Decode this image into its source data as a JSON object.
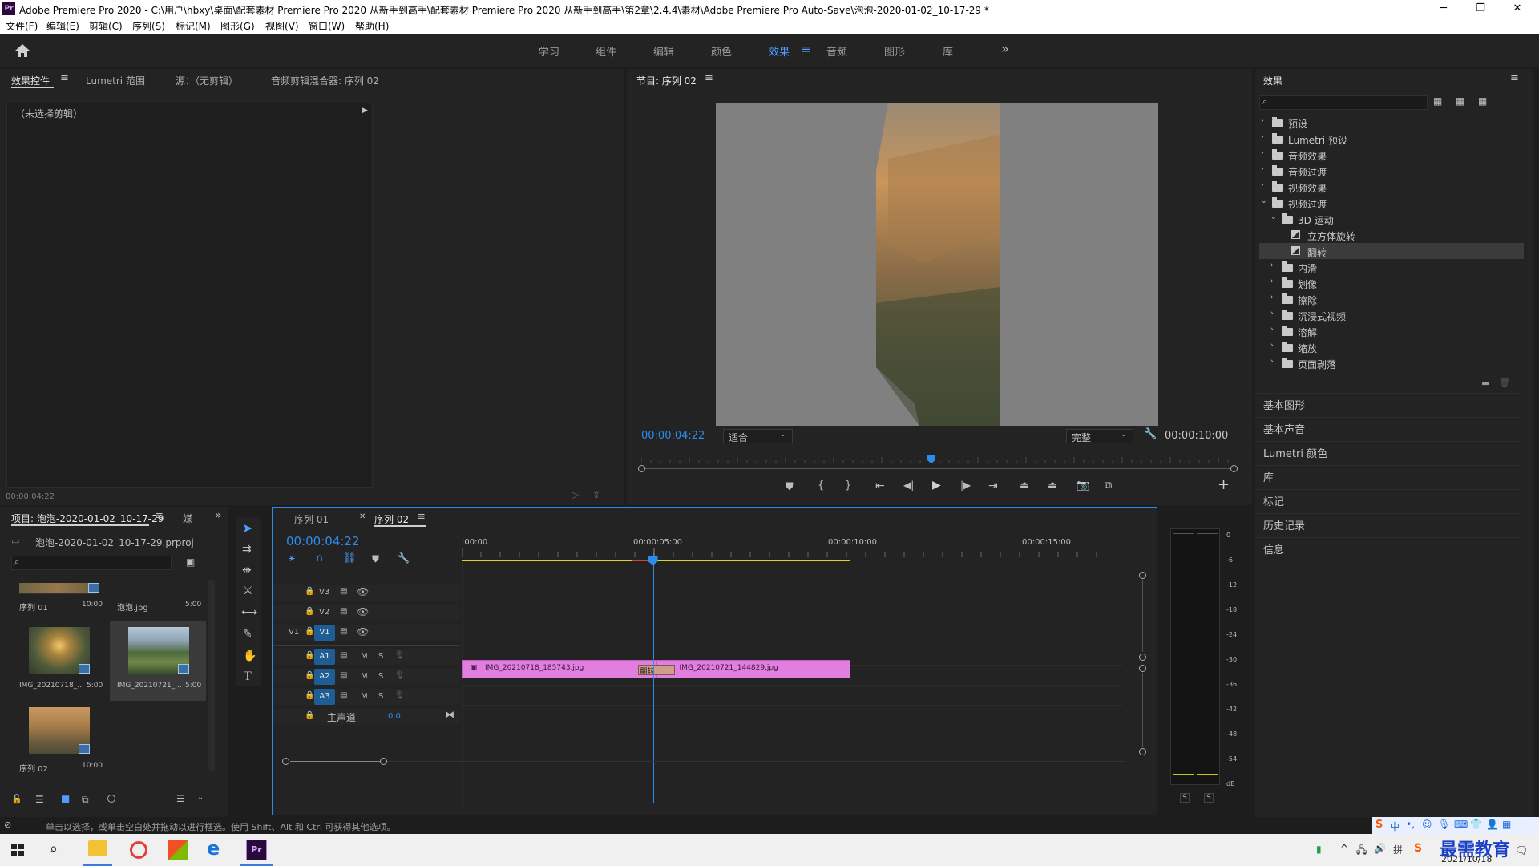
{
  "window": {
    "title": "Adobe Premiere Pro 2020 - C:\\用户\\hbxy\\桌面\\配套素材 Premiere Pro 2020 从新手到高手\\配套素材 Premiere Pro 2020 从新手到高手\\第2章\\2.4.4\\素材\\Adobe Premiere Pro Auto-Save\\泡泡-2020-01-02_10-17-29 *",
    "app_icon": "Pr",
    "minimize": "─",
    "maximize": "❐",
    "close": "✕"
  },
  "menu": [
    "文件(F)",
    "编辑(E)",
    "剪辑(C)",
    "序列(S)",
    "标记(M)",
    "图形(G)",
    "视图(V)",
    "窗口(W)",
    "帮助(H)"
  ],
  "workspaces": {
    "items": [
      "学习",
      "组件",
      "编辑",
      "颜色",
      "效果",
      "音频",
      "图形",
      "库"
    ],
    "active": "效果",
    "more": "»"
  },
  "source_panel": {
    "tabs": [
      "效果控件",
      "Lumetri 范围",
      "源：（无剪辑）",
      "音频剪辑混合器: 序列 02"
    ],
    "no_clip": "（未选择剪辑）",
    "timecode": "00:00:04:22"
  },
  "program_monitor": {
    "title": "节目: 序列 02",
    "timecode": "00:00:04:22",
    "fit": "适合",
    "quality": "完整",
    "duration": "00:00:10:00",
    "playhead_fraction": 0.489
  },
  "project_panel": {
    "tab": "项目: 泡泡-2020-01-02_10-17-29",
    "tab2": "媒",
    "file": "泡泡-2020-01-02_10-17-29.prproj",
    "items": [
      {
        "name": "序列 01",
        "duration": "10:00"
      },
      {
        "name": "泡泡.jpg",
        "duration": "5:00"
      },
      {
        "name": "IMG_20210718_...",
        "duration": "5:00"
      },
      {
        "name": "IMG_20210721_...",
        "duration": "5:00"
      },
      {
        "name": "序列 02",
        "duration": "10:00"
      }
    ]
  },
  "timeline": {
    "tabs": [
      "序列 01",
      "序列 02"
    ],
    "timecode": "00:00:04:22",
    "ruler": [
      ":00:00",
      "00:00:05:00",
      "00:00:10:00",
      "00:00:15:00"
    ],
    "video_tracks": [
      "V3",
      "V2",
      "V1"
    ],
    "audio_tracks": [
      "A1",
      "A2",
      "A3"
    ],
    "source_patch": "V1",
    "master": "主声道",
    "master_value": "0.0",
    "clips": [
      {
        "name": "IMG_20210718_185743.jpg",
        "start": 0.0,
        "end": 5.0
      },
      {
        "name": "IMG_20210721_144829.jpg",
        "start": 5.0,
        "end": 10.0
      }
    ],
    "transition": "翻转",
    "playhead_seconds": 4.92,
    "m_label": "M",
    "s_label": "S"
  },
  "meter": {
    "scale": [
      "0",
      "-6",
      "-12",
      "-18",
      "-24",
      "-30",
      "-36",
      "-42",
      "-48",
      "-54",
      "dB"
    ],
    "solo": [
      "S",
      "S"
    ]
  },
  "effects_panel": {
    "title": "效果",
    "tree": [
      {
        "label": "预设",
        "level": 0,
        "type": "folder-special",
        "expanded": false
      },
      {
        "label": "Lumetri 预设",
        "level": 0,
        "type": "folder-special",
        "expanded": false
      },
      {
        "label": "音频效果",
        "level": 0,
        "type": "folder",
        "expanded": false
      },
      {
        "label": "音频过渡",
        "level": 0,
        "type": "folder",
        "expanded": false
      },
      {
        "label": "视频效果",
        "level": 0,
        "type": "folder",
        "expanded": false
      },
      {
        "label": "视频过渡",
        "level": 0,
        "type": "folder",
        "expanded": true
      },
      {
        "label": "3D 运动",
        "level": 1,
        "type": "folder",
        "expanded": true
      },
      {
        "label": "立方体旋转",
        "level": 2,
        "type": "effect"
      },
      {
        "label": "翻转",
        "level": 2,
        "type": "effect",
        "selected": true
      },
      {
        "label": "内滑",
        "level": 1,
        "type": "folder",
        "expanded": false
      },
      {
        "label": "划像",
        "level": 1,
        "type": "folder",
        "expanded": false
      },
      {
        "label": "擦除",
        "level": 1,
        "type": "folder",
        "expanded": false
      },
      {
        "label": "沉浸式视频",
        "level": 1,
        "type": "folder",
        "expanded": false
      },
      {
        "label": "溶解",
        "level": 1,
        "type": "folder",
        "expanded": false
      },
      {
        "label": "缩放",
        "level": 1,
        "type": "folder",
        "expanded": false
      },
      {
        "label": "页面剥落",
        "level": 1,
        "type": "folder",
        "expanded": false
      }
    ],
    "sections": [
      "基本图形",
      "基本声音",
      "Lumetri 颜色",
      "库",
      "标记",
      "历史记录",
      "信息"
    ]
  },
  "status_bar": "单击以选择，或单击空白处并拖动以进行框选。使用 Shift、Alt 和 Ctrl 可获得其他选项。",
  "taskbar": {
    "date": "2021/10/18",
    "ime": "中",
    "watermark": "最需教育"
  },
  "colors": {
    "accent": "#2d8ceb",
    "clip": "#e17ee0",
    "transition": "#cf9d8e",
    "work_area": "#d6d629",
    "target": "#1e5d96"
  }
}
